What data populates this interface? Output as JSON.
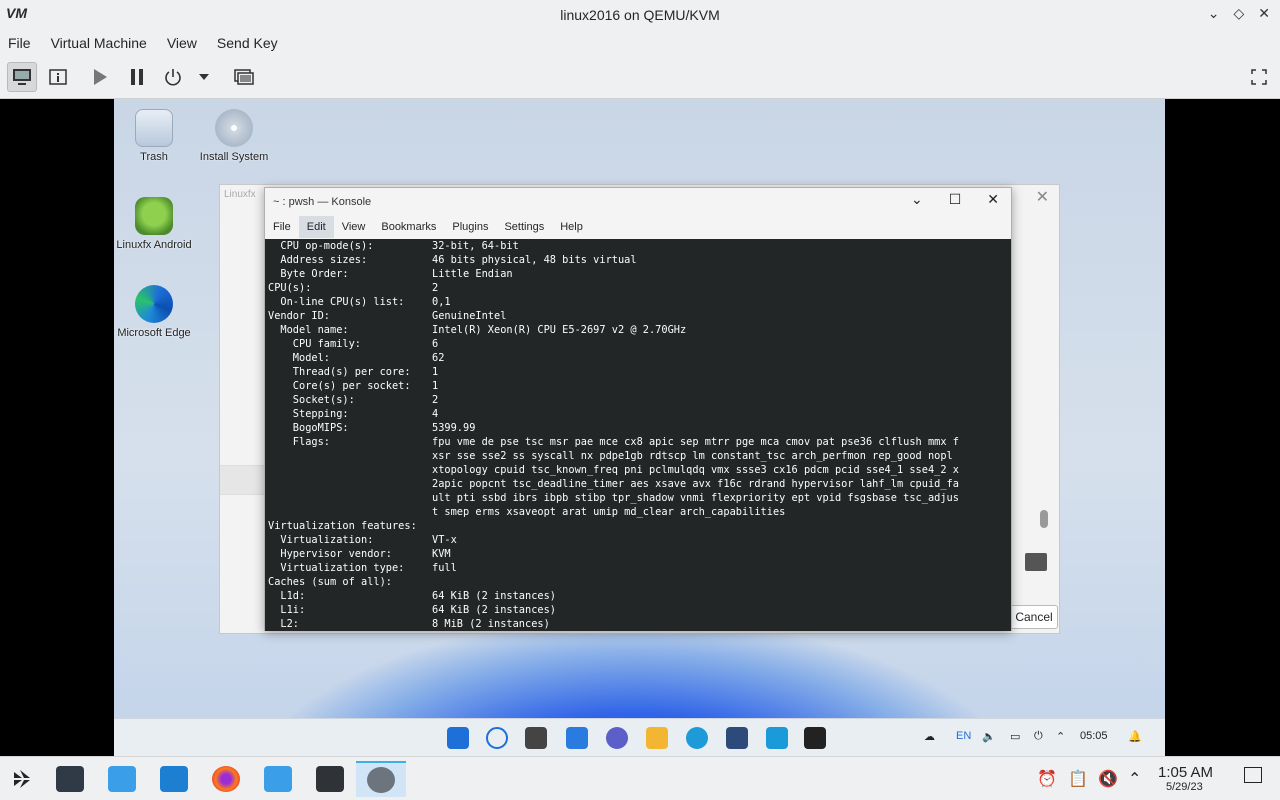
{
  "host": {
    "title": "linux2016 on QEMU/KVM",
    "logo": "VM",
    "menu": [
      "File",
      "Virtual Machine",
      "View",
      "Send Key"
    ],
    "toolbar_icons": [
      "monitor-icon",
      "info-icon",
      "play-icon",
      "pause-icon",
      "power-icon",
      "chevron-down-icon",
      "snapshot-icon",
      "fullscreen-icon"
    ]
  },
  "guest": {
    "desktop_icons": [
      {
        "label": "Trash"
      },
      {
        "label": "Install System"
      },
      {
        "label": "Linuxfx Android"
      },
      {
        "label": "Microsoft Edge"
      }
    ],
    "bg_dialog": {
      "title": "Linuxfx",
      "cancel": "Cancel"
    },
    "konsole": {
      "title": "~ : pwsh — Konsole",
      "menu": [
        "File",
        "Edit",
        "View",
        "Bookmarks",
        "Plugins",
        "Settings",
        "Help"
      ],
      "lines": [
        {
          "k": "  CPU op-mode(s):",
          "v": "32-bit, 64-bit"
        },
        {
          "k": "  Address sizes:",
          "v": "46 bits physical, 48 bits virtual"
        },
        {
          "k": "  Byte Order:",
          "v": "Little Endian"
        },
        {
          "k": "CPU(s):",
          "v": "2"
        },
        {
          "k": "  On-line CPU(s) list:",
          "v": "0,1"
        },
        {
          "k": "Vendor ID:",
          "v": "GenuineIntel"
        },
        {
          "k": "  Model name:",
          "v": "Intel(R) Xeon(R) CPU E5-2697 v2 @ 2.70GHz"
        },
        {
          "k": "    CPU family:",
          "v": "6"
        },
        {
          "k": "    Model:",
          "v": "62"
        },
        {
          "k": "    Thread(s) per core:",
          "v": "1"
        },
        {
          "k": "    Core(s) per socket:",
          "v": "1"
        },
        {
          "k": "    Socket(s):",
          "v": "2"
        },
        {
          "k": "    Stepping:",
          "v": "4"
        },
        {
          "k": "    BogoMIPS:",
          "v": "5399.99"
        },
        {
          "k": "    Flags:",
          "v": "fpu vme de pse tsc msr pae mce cx8 apic sep mtrr pge mca cmov pat pse36 clflush mmx f"
        },
        {
          "k": "",
          "v": "xsr sse sse2 ss syscall nx pdpe1gb rdtscp lm constant_tsc arch_perfmon rep_good nopl"
        },
        {
          "k": "",
          "v": "xtopology cpuid tsc_known_freq pni pclmulqdq vmx ssse3 cx16 pdcm pcid sse4_1 sse4_2 x"
        },
        {
          "k": "",
          "v": "2apic popcnt tsc_deadline_timer aes xsave avx f16c rdrand hypervisor lahf_lm cpuid_fa"
        },
        {
          "k": "",
          "v": "ult pti ssbd ibrs ibpb stibp tpr_shadow vnmi flexpriority ept vpid fsgsbase tsc_adjus"
        },
        {
          "k": "",
          "v": "t smep erms xsaveopt arat umip md_clear arch_capabilities"
        },
        {
          "k": "Virtualization features:",
          "v": ""
        },
        {
          "k": "  Virtualization:",
          "v": "VT-x"
        },
        {
          "k": "  Hypervisor vendor:",
          "v": "KVM"
        },
        {
          "k": "  Virtualization type:",
          "v": "full"
        },
        {
          "k": "Caches (sum of all):",
          "v": ""
        },
        {
          "k": "  L1d:",
          "v": "64 KiB (2 instances)"
        },
        {
          "k": "  L1i:",
          "v": "64 KiB (2 instances)"
        },
        {
          "k": "  L2:",
          "v": "8 MiB (2 instances)"
        }
      ]
    },
    "taskbar": {
      "lang": "EN",
      "time": "05:05"
    }
  },
  "panel": {
    "time": "1:05 AM",
    "date": "5/29/23",
    "accent": "#3daee9"
  }
}
